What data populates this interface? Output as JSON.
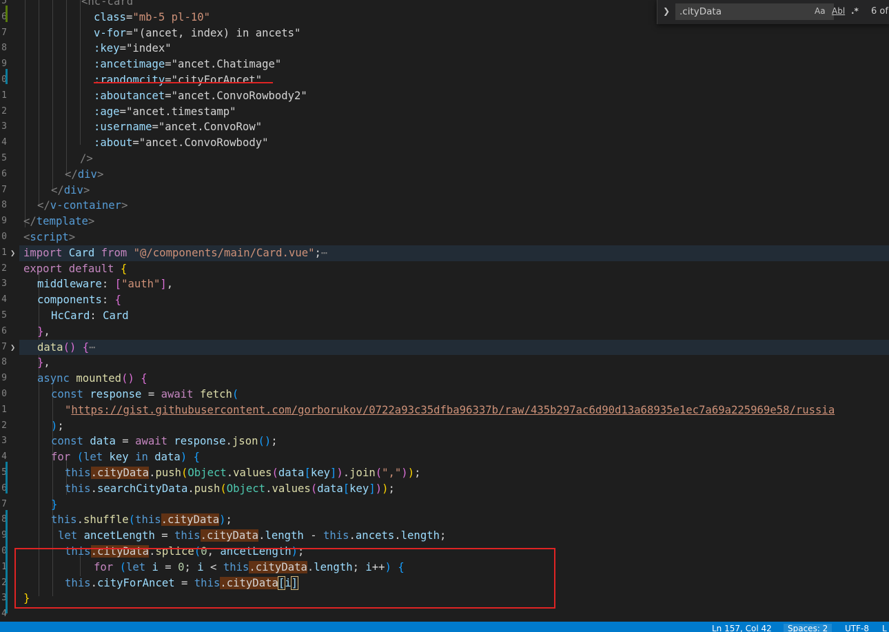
{
  "find_widget": {
    "query": ".cityData",
    "match_case_label": "Aa",
    "whole_word_label": "Abl",
    "regex_label": ".*",
    "result_count": "6 of"
  },
  "status_bar": {
    "position": "Ln 157, Col 42",
    "spaces": "Spaces: 2",
    "encoding": "UTF-8",
    "eol": "L"
  },
  "line_numbers": [
    "5",
    "6",
    "7",
    "8",
    "9",
    "0",
    "1",
    "2",
    "3",
    "4",
    "5",
    "6",
    "7",
    "8",
    "9",
    "0",
    "1",
    "2",
    "3",
    "4",
    "5",
    "6",
    "7",
    "8",
    "9",
    "0",
    "1",
    "2",
    "3",
    "4",
    "5",
    "6",
    "7",
    "8",
    "9",
    "0",
    "1",
    "2",
    "3",
    "4"
  ],
  "code_lines": [
    {
      "indent": 118,
      "tokens": [
        {
          "t": "<hc-card",
          "c": "t-tag"
        }
      ]
    },
    {
      "indent": 136,
      "tokens": [
        {
          "t": "class",
          "c": "t-attr"
        },
        {
          "t": "=",
          "c": "t-text"
        },
        {
          "t": "\"mb-5 pl-10\"",
          "c": "t-str"
        }
      ]
    },
    {
      "indent": 136,
      "tokens": [
        {
          "t": "v-for",
          "c": "t-attr"
        },
        {
          "t": "=\"(ancet, index) in ancets\"",
          "c": "t-text"
        }
      ]
    },
    {
      "indent": 136,
      "tokens": [
        {
          "t": ":key",
          "c": "t-attr"
        },
        {
          "t": "=\"index\"",
          "c": "t-text"
        }
      ]
    },
    {
      "indent": 136,
      "tokens": [
        {
          "t": ":ancetimage",
          "c": "t-attr"
        },
        {
          "t": "=\"ancet.Chatimage\"",
          "c": "t-text"
        }
      ]
    },
    {
      "indent": 136,
      "tokens": [
        {
          "t": ":randomcity",
          "c": "t-attr"
        },
        {
          "t": "=\"cityForAncet\"",
          "c": "t-text"
        }
      ]
    },
    {
      "indent": 136,
      "tokens": [
        {
          "t": ":aboutancet",
          "c": "t-attr"
        },
        {
          "t": "=\"ancet.ConvoRowbody2\"",
          "c": "t-text"
        }
      ]
    },
    {
      "indent": 136,
      "tokens": [
        {
          "t": ":age",
          "c": "t-attr"
        },
        {
          "t": "=\"ancet.timestamp\"",
          "c": "t-text"
        }
      ]
    },
    {
      "indent": 136,
      "tokens": [
        {
          "t": ":username",
          "c": "t-attr"
        },
        {
          "t": "=\"ancet.ConvoRow\"",
          "c": "t-text"
        }
      ]
    },
    {
      "indent": 136,
      "tokens": [
        {
          "t": ":about",
          "c": "t-attr"
        },
        {
          "t": "=\"ancet.ConvoRowbody\"",
          "c": "t-text"
        }
      ]
    },
    {
      "indent": 116,
      "tokens": [
        {
          "t": "/>",
          "c": "t-tag"
        }
      ]
    },
    {
      "indent": 94,
      "tokens": [
        {
          "t": "</",
          "c": "t-tag"
        },
        {
          "t": "div",
          "c": "t-tagname"
        },
        {
          "t": ">",
          "c": "t-tag"
        }
      ]
    },
    {
      "indent": 74,
      "tokens": [
        {
          "t": "</",
          "c": "t-tag"
        },
        {
          "t": "div",
          "c": "t-tagname"
        },
        {
          "t": ">",
          "c": "t-tag"
        }
      ]
    },
    {
      "indent": 54,
      "tokens": [
        {
          "t": "</",
          "c": "t-tag"
        },
        {
          "t": "v-container",
          "c": "t-tagname"
        },
        {
          "t": ">",
          "c": "t-tag"
        }
      ]
    },
    {
      "indent": 34,
      "tokens": [
        {
          "t": "</",
          "c": "t-tag"
        },
        {
          "t": "template",
          "c": "t-tagname"
        },
        {
          "t": ">",
          "c": "t-tag"
        }
      ]
    },
    {
      "indent": 34,
      "tokens": [
        {
          "t": "<",
          "c": "t-tag"
        },
        {
          "t": "script",
          "c": "t-tagname"
        },
        {
          "t": ">",
          "c": "t-tag"
        }
      ]
    },
    {
      "indent": 34,
      "hl": true,
      "fold": true,
      "tokens": [
        {
          "t": "import ",
          "c": "t-kw2"
        },
        {
          "t": "Card ",
          "c": "t-var"
        },
        {
          "t": "from ",
          "c": "t-kw2"
        },
        {
          "t": "\"@/components/main/Card.vue\"",
          "c": "t-str"
        },
        {
          "t": ";",
          "c": "t-text"
        },
        {
          "t": "⋯",
          "c": "t-dim"
        }
      ]
    },
    {
      "indent": 34,
      "tokens": [
        {
          "t": "export ",
          "c": "t-kw2"
        },
        {
          "t": "default ",
          "c": "t-kw2"
        },
        {
          "t": "{",
          "c": "t-br1"
        }
      ]
    },
    {
      "indent": 54,
      "tokens": [
        {
          "t": "middleware",
          "c": "t-var"
        },
        {
          "t": ": ",
          "c": "t-text"
        },
        {
          "t": "[",
          "c": "t-br2"
        },
        {
          "t": "\"auth\"",
          "c": "t-str"
        },
        {
          "t": "]",
          "c": "t-br2"
        },
        {
          "t": ",",
          "c": "t-text"
        }
      ]
    },
    {
      "indent": 54,
      "tokens": [
        {
          "t": "components",
          "c": "t-var"
        },
        {
          "t": ": ",
          "c": "t-text"
        },
        {
          "t": "{",
          "c": "t-br2"
        }
      ]
    },
    {
      "indent": 74,
      "tokens": [
        {
          "t": "HcCard",
          "c": "t-var"
        },
        {
          "t": ": ",
          "c": "t-text"
        },
        {
          "t": "Card",
          "c": "t-var"
        }
      ]
    },
    {
      "indent": 54,
      "tokens": [
        {
          "t": "}",
          "c": "t-br2"
        },
        {
          "t": ",",
          "c": "t-text"
        }
      ]
    },
    {
      "indent": 54,
      "hl": true,
      "fold": true,
      "tokens": [
        {
          "t": "data",
          "c": "t-func"
        },
        {
          "t": "() ",
          "c": "t-br2"
        },
        {
          "t": "{",
          "c": "t-br2"
        },
        {
          "t": "⋯",
          "c": "t-dim"
        }
      ]
    },
    {
      "indent": 54,
      "tokens": [
        {
          "t": "}",
          "c": "t-br2"
        },
        {
          "t": ",",
          "c": "t-text"
        }
      ]
    },
    {
      "indent": 54,
      "tokens": [
        {
          "t": "async ",
          "c": "t-kw"
        },
        {
          "t": "mounted",
          "c": "t-func"
        },
        {
          "t": "() ",
          "c": "t-br2"
        },
        {
          "t": "{",
          "c": "t-br2"
        }
      ]
    },
    {
      "indent": 74,
      "tokens": [
        {
          "t": "const ",
          "c": "t-kw"
        },
        {
          "t": "response ",
          "c": "t-var"
        },
        {
          "t": "= ",
          "c": "t-text"
        },
        {
          "t": "await ",
          "c": "t-kw2"
        },
        {
          "t": "fetch",
          "c": "t-func"
        },
        {
          "t": "(",
          "c": "t-br3"
        }
      ]
    },
    {
      "indent": 94,
      "tokens": [
        {
          "t": "\"",
          "c": "t-str"
        },
        {
          "t": "https://gist.githubusercontent.com/gorborukov/0722a93c35dfba96337b/raw/435b297ac6d90d13a68935e1ec7a69a225969e58/russia",
          "c": "t-link"
        }
      ]
    },
    {
      "indent": 74,
      "tokens": [
        {
          "t": ")",
          "c": "t-br3"
        },
        {
          "t": ";",
          "c": "t-text"
        }
      ]
    },
    {
      "indent": 74,
      "tokens": [
        {
          "t": "const ",
          "c": "t-kw"
        },
        {
          "t": "data ",
          "c": "t-var"
        },
        {
          "t": "= ",
          "c": "t-text"
        },
        {
          "t": "await ",
          "c": "t-kw2"
        },
        {
          "t": "response",
          "c": "t-var"
        },
        {
          "t": ".",
          "c": "t-text"
        },
        {
          "t": "json",
          "c": "t-func"
        },
        {
          "t": "()",
          "c": "t-br3"
        },
        {
          "t": ";",
          "c": "t-text"
        }
      ]
    },
    {
      "indent": 74,
      "tokens": [
        {
          "t": "for ",
          "c": "t-kw2"
        },
        {
          "t": "(",
          "c": "t-br3"
        },
        {
          "t": "let ",
          "c": "t-kw"
        },
        {
          "t": "key ",
          "c": "t-var"
        },
        {
          "t": "in ",
          "c": "t-kw"
        },
        {
          "t": "data",
          "c": "t-var"
        },
        {
          "t": ") ",
          "c": "t-br3"
        },
        {
          "t": "{",
          "c": "t-br3"
        }
      ]
    },
    {
      "indent": 94,
      "tokens": [
        {
          "t": "this",
          "c": "t-kw"
        },
        {
          "t": ".cityData",
          "c": "t-match t-var"
        },
        {
          "t": ".",
          "c": "t-text"
        },
        {
          "t": "push",
          "c": "t-func"
        },
        {
          "t": "(",
          "c": "t-br1"
        },
        {
          "t": "Object",
          "c": "t-class"
        },
        {
          "t": ".",
          "c": "t-text"
        },
        {
          "t": "values",
          "c": "t-func"
        },
        {
          "t": "(",
          "c": "t-br2"
        },
        {
          "t": "data",
          "c": "t-var"
        },
        {
          "t": "[",
          "c": "t-br3"
        },
        {
          "t": "key",
          "c": "t-var"
        },
        {
          "t": "]",
          "c": "t-br3"
        },
        {
          "t": ")",
          "c": "t-br2"
        },
        {
          "t": ".",
          "c": "t-text"
        },
        {
          "t": "join",
          "c": "t-func"
        },
        {
          "t": "(",
          "c": "t-br2"
        },
        {
          "t": "\",\"",
          "c": "t-str"
        },
        {
          "t": ")",
          "c": "t-br2"
        },
        {
          "t": ")",
          "c": "t-br1"
        },
        {
          "t": ";",
          "c": "t-text"
        }
      ]
    },
    {
      "indent": 94,
      "tokens": [
        {
          "t": "this",
          "c": "t-kw"
        },
        {
          "t": ".",
          "c": "t-text"
        },
        {
          "t": "searchCityData",
          "c": "t-var"
        },
        {
          "t": ".",
          "c": "t-text"
        },
        {
          "t": "push",
          "c": "t-func"
        },
        {
          "t": "(",
          "c": "t-br1"
        },
        {
          "t": "Object",
          "c": "t-class"
        },
        {
          "t": ".",
          "c": "t-text"
        },
        {
          "t": "values",
          "c": "t-func"
        },
        {
          "t": "(",
          "c": "t-br2"
        },
        {
          "t": "data",
          "c": "t-var"
        },
        {
          "t": "[",
          "c": "t-br3"
        },
        {
          "t": "key",
          "c": "t-var"
        },
        {
          "t": "]",
          "c": "t-br3"
        },
        {
          "t": ")",
          "c": "t-br2"
        },
        {
          "t": ")",
          "c": "t-br1"
        },
        {
          "t": ";",
          "c": "t-text"
        }
      ]
    },
    {
      "indent": 74,
      "tokens": [
        {
          "t": "}",
          "c": "t-br3"
        }
      ]
    },
    {
      "indent": 74,
      "tokens": [
        {
          "t": "this",
          "c": "t-kw"
        },
        {
          "t": ".",
          "c": "t-text"
        },
        {
          "t": "shuffle",
          "c": "t-func"
        },
        {
          "t": "(",
          "c": "t-br3"
        },
        {
          "t": "this",
          "c": "t-kw"
        },
        {
          "t": ".cityData",
          "c": "t-match t-var"
        },
        {
          "t": ")",
          "c": "t-br3"
        },
        {
          "t": ";",
          "c": "t-text"
        }
      ]
    },
    {
      "indent": 84,
      "tokens": [
        {
          "t": "let ",
          "c": "t-kw"
        },
        {
          "t": "ancetLength ",
          "c": "t-var"
        },
        {
          "t": "= ",
          "c": "t-text"
        },
        {
          "t": "this",
          "c": "t-kw"
        },
        {
          "t": ".cityData",
          "c": "t-match t-var"
        },
        {
          "t": ".",
          "c": "t-text"
        },
        {
          "t": "length ",
          "c": "t-var"
        },
        {
          "t": "- ",
          "c": "t-text"
        },
        {
          "t": "this",
          "c": "t-kw"
        },
        {
          "t": ".",
          "c": "t-text"
        },
        {
          "t": "ancets",
          "c": "t-var"
        },
        {
          "t": ".",
          "c": "t-text"
        },
        {
          "t": "length",
          "c": "t-var"
        },
        {
          "t": ";",
          "c": "t-text"
        }
      ]
    },
    {
      "indent": 94,
      "tokens": [
        {
          "t": "this",
          "c": "t-kw"
        },
        {
          "t": ".cityData",
          "c": "t-match t-var"
        },
        {
          "t": ".",
          "c": "t-text"
        },
        {
          "t": "splice",
          "c": "t-func"
        },
        {
          "t": "(",
          "c": "t-br3"
        },
        {
          "t": "0",
          "c": "t-num"
        },
        {
          "t": ", ",
          "c": "t-text"
        },
        {
          "t": "ancetLength",
          "c": "t-var"
        },
        {
          "t": ")",
          "c": "t-br3"
        },
        {
          "t": ";",
          "c": "t-text"
        }
      ]
    },
    {
      "indent": 136,
      "tokens": [
        {
          "t": "for ",
          "c": "t-kw2"
        },
        {
          "t": "(",
          "c": "t-br3"
        },
        {
          "t": "let ",
          "c": "t-kw"
        },
        {
          "t": "i ",
          "c": "t-var"
        },
        {
          "t": "= ",
          "c": "t-text"
        },
        {
          "t": "0",
          "c": "t-num"
        },
        {
          "t": "; ",
          "c": "t-text"
        },
        {
          "t": "i ",
          "c": "t-var"
        },
        {
          "t": "< ",
          "c": "t-text"
        },
        {
          "t": "this",
          "c": "t-kw"
        },
        {
          "t": ".cityData",
          "c": "t-match t-var"
        },
        {
          "t": ".",
          "c": "t-text"
        },
        {
          "t": "length",
          "c": "t-var"
        },
        {
          "t": "; ",
          "c": "t-text"
        },
        {
          "t": "i",
          "c": "t-var"
        },
        {
          "t": "++",
          "c": "t-text"
        },
        {
          "t": ") ",
          "c": "t-br3"
        },
        {
          "t": "{",
          "c": "t-br3"
        }
      ]
    },
    {
      "indent": 94,
      "tokens": [
        {
          "t": "this",
          "c": "t-kw"
        },
        {
          "t": ".",
          "c": "t-text"
        },
        {
          "t": "cityForAncet ",
          "c": "t-var"
        },
        {
          "t": "= ",
          "c": "t-text"
        },
        {
          "t": "this",
          "c": "t-kw"
        },
        {
          "t": ".cityData",
          "c": "t-match t-var"
        },
        {
          "t": "[",
          "c": "t-br1 t-cursor"
        },
        {
          "t": "i",
          "c": "t-var"
        },
        {
          "t": "]",
          "c": "t-br1 t-cursor"
        }
      ]
    },
    {
      "indent": 34,
      "tokens": [
        {
          "t": "}",
          "c": "t-br1"
        }
      ]
    },
    {
      "indent": 34,
      "tokens": []
    }
  ]
}
